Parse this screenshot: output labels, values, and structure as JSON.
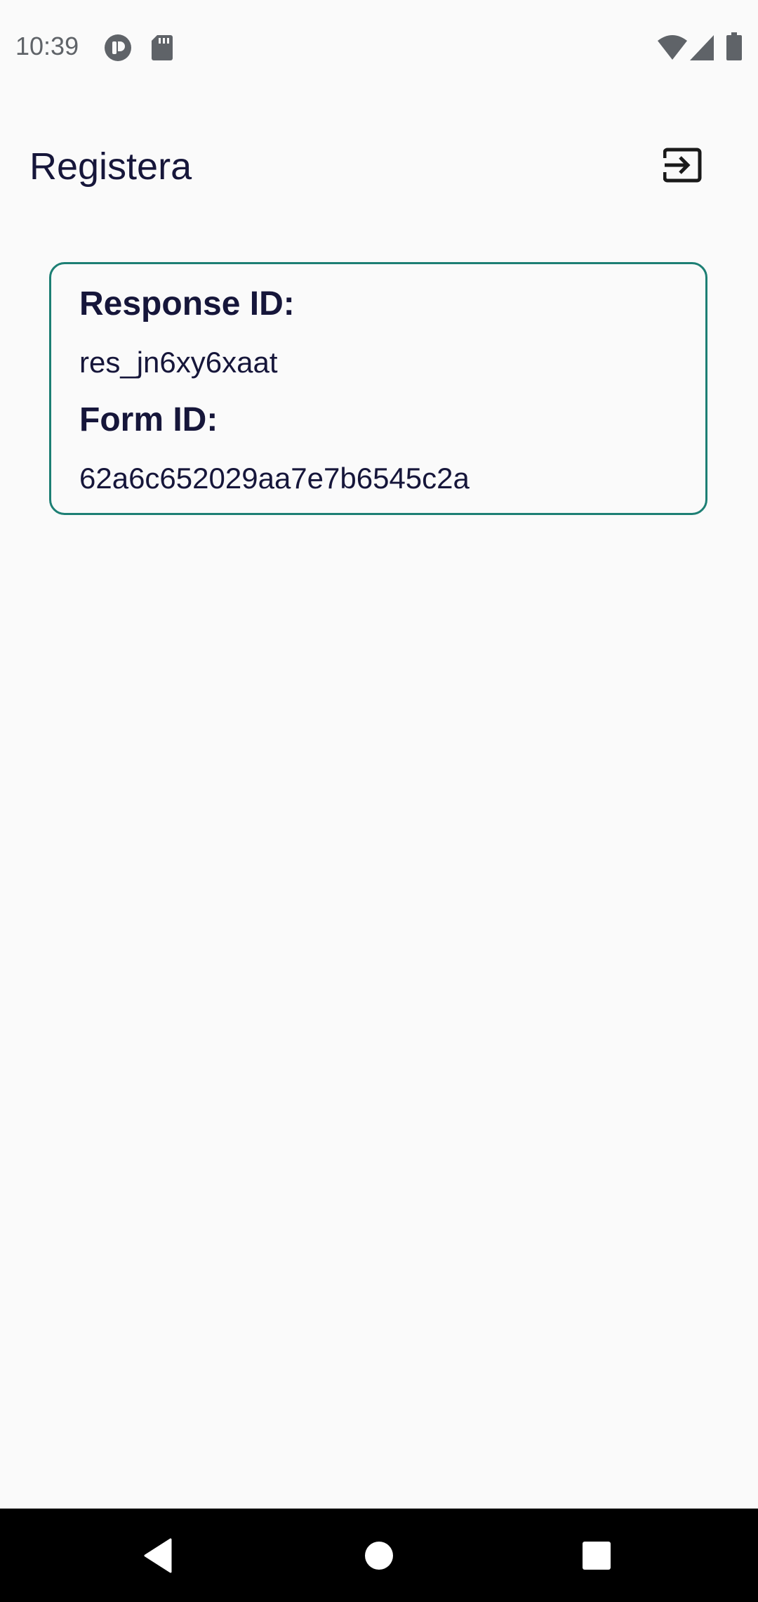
{
  "status_bar": {
    "time": "10:39",
    "icons": [
      "notification-app-icon",
      "sd-card-icon",
      "wifi-icon",
      "cell-signal-icon",
      "battery-icon"
    ]
  },
  "app_bar": {
    "title": "Registera",
    "action_icon": "logout-icon"
  },
  "card": {
    "response_id_label": "Response ID:",
    "response_id_value": "res_jn6xy6xaat",
    "form_id_label": "Form ID:",
    "form_id_value": "62a6c652029aa7e7b6545c2a",
    "border_color": "#1d7f74"
  },
  "nav_bar": {
    "buttons": [
      "back-icon",
      "home-icon",
      "recents-icon"
    ]
  },
  "colors": {
    "background": "#fafafa",
    "text_primary": "#16163a",
    "accent": "#1d7f74"
  }
}
